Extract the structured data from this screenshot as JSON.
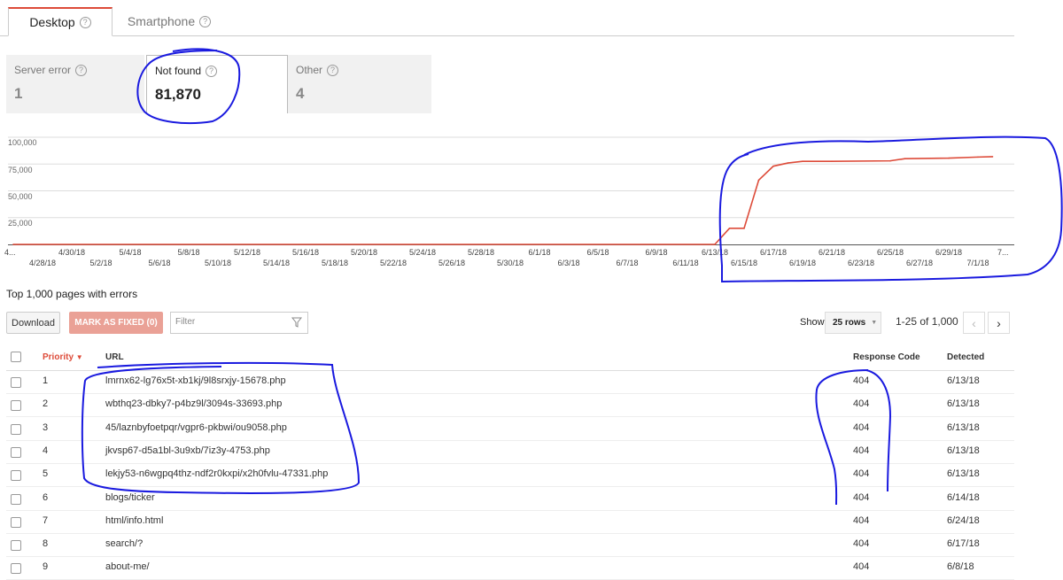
{
  "tabs": [
    "Desktop",
    "Smartphone"
  ],
  "stats": [
    {
      "label": "Server error",
      "value": "1"
    },
    {
      "label": "Not found",
      "value": "81,870"
    },
    {
      "label": "Other",
      "value": "4"
    }
  ],
  "chart": {
    "y_ticks": [
      "100,000",
      "75,000",
      "50,000",
      "25,000"
    ],
    "left_edge_label": "4...",
    "right_edge_label": "7...",
    "x_ticks_upper": [
      "4/30/18",
      "5/4/18",
      "5/8/18",
      "5/12/18",
      "5/16/18",
      "5/20/18",
      "5/24/18",
      "5/28/18",
      "6/1/18",
      "6/5/18",
      "6/9/18",
      "6/13/18",
      "6/17/18",
      "6/21/18",
      "6/25/18",
      "6/29/18"
    ],
    "x_ticks_lower": [
      "4/28/18",
      "5/2/18",
      "5/6/18",
      "5/10/18",
      "5/14/18",
      "5/18/18",
      "5/22/18",
      "5/26/18",
      "5/30/18",
      "6/3/18",
      "6/7/18",
      "6/11/18",
      "6/15/18",
      "6/19/18",
      "6/23/18",
      "6/27/18",
      "7/1/18"
    ],
    "line_color": "#dd4b39"
  },
  "chart_data": {
    "type": "line",
    "x": [
      "4/26/18",
      "6/13/18",
      "6/14/18",
      "6/15/18",
      "6/16/18",
      "6/17/18",
      "6/18/18",
      "6/19/18",
      "6/21/18",
      "6/25/18",
      "6/26/18",
      "6/29/18",
      "7/1/18",
      "7/2/18"
    ],
    "series": [
      {
        "values": [
          0,
          0,
          15000,
          15000,
          60000,
          73000,
          76000,
          77500,
          77500,
          78000,
          80000,
          80500,
          81500,
          81870
        ]
      }
    ],
    "ylim": [
      0,
      100000
    ],
    "grid": true
  },
  "table": {
    "caption": "Top 1,000 pages with errors",
    "download_label": "Download",
    "mark_fixed_label": "MARK AS FIXED (0)",
    "filter_placeholder": "Filter",
    "show_label": "Show",
    "rows_select": "25 rows",
    "page_info": "1-25 of 1,000",
    "prev_icon": "‹",
    "next_icon": "›",
    "headers": {
      "priority": "Priority",
      "url": "URL",
      "code": "Response Code",
      "detected": "Detected"
    },
    "rows": [
      {
        "priority": "1",
        "url": "lmrnx62-lg76x5t-xb1kj/9l8srxjy-15678.php",
        "code": "404",
        "detected": "6/13/18"
      },
      {
        "priority": "2",
        "url": "wbthq23-dbky7-p4bz9l/3094s-33693.php",
        "code": "404",
        "detected": "6/13/18"
      },
      {
        "priority": "3",
        "url": "45/laznbyfoetpqr/vgpr6-pkbwi/ou9058.php",
        "code": "404",
        "detected": "6/13/18"
      },
      {
        "priority": "4",
        "url": "jkvsp67-d5a1bl-3u9xb/7iz3y-4753.php",
        "code": "404",
        "detected": "6/13/18"
      },
      {
        "priority": "5",
        "url": "lekjy53-n6wgpq4thz-ndf2r0kxpi/x2h0fvlu-47331.php",
        "code": "404",
        "detected": "6/13/18"
      },
      {
        "priority": "6",
        "url": "blogs/ticker",
        "code": "404",
        "detected": "6/14/18"
      },
      {
        "priority": "7",
        "url": "html/info.html",
        "code": "404",
        "detected": "6/24/18"
      },
      {
        "priority": "8",
        "url": "search/?",
        "code": "404",
        "detected": "6/17/18"
      },
      {
        "priority": "9",
        "url": "about-me/",
        "code": "404",
        "detected": "6/8/18"
      }
    ]
  }
}
